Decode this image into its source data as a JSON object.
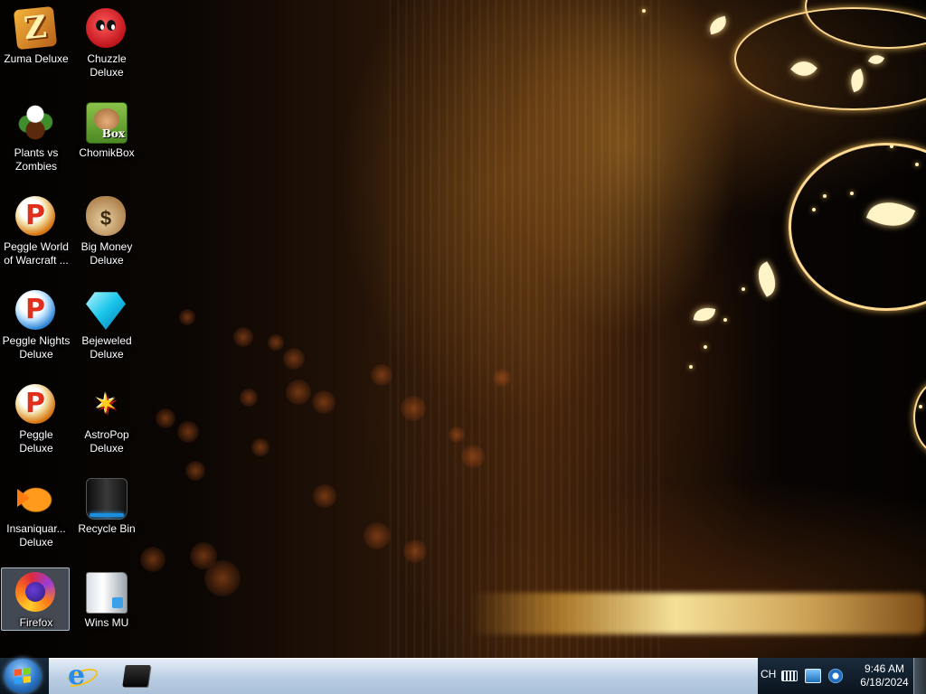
{
  "desktop": {
    "icons": [
      {
        "label": "Zuma Deluxe",
        "icon": "zuma-icon"
      },
      {
        "label": "Chuzzle Deluxe",
        "icon": "chuzzle-icon"
      },
      {
        "label": "Plants vs Zombies",
        "icon": "plants-vs-zombies-icon"
      },
      {
        "label": "ChomikBox",
        "icon": "chomikbox-icon"
      },
      {
        "label": "Peggle World of Warcraft ...",
        "icon": "peggle-icon"
      },
      {
        "label": "Big Money Deluxe",
        "icon": "money-bag-icon"
      },
      {
        "label": "Peggle Nights Deluxe",
        "icon": "peggle-nights-icon"
      },
      {
        "label": "Bejeweled Deluxe",
        "icon": "gem-icon"
      },
      {
        "label": "Peggle Deluxe",
        "icon": "peggle-icon"
      },
      {
        "label": "AstroPop Deluxe",
        "icon": "astropop-icon"
      },
      {
        "label": "Insaniquar... Deluxe",
        "icon": "fish-icon"
      },
      {
        "label": "Recycle Bin",
        "icon": "recycle-bin-icon"
      },
      {
        "label": "Firefox",
        "icon": "firefox-icon",
        "selected": true
      },
      {
        "label": "Wins MU",
        "icon": "folder-file-icon"
      }
    ],
    "box_badge": "Box"
  },
  "taskbar": {
    "pinned": [
      {
        "name": "Internet Explorer",
        "icon": "internet-explorer-icon"
      },
      {
        "name": "Device",
        "icon": "device-icon"
      }
    ],
    "tray": {
      "language": "CH",
      "time": "9:46 AM",
      "date": "6/18/2024"
    },
    "accent": "#b9cde2"
  }
}
